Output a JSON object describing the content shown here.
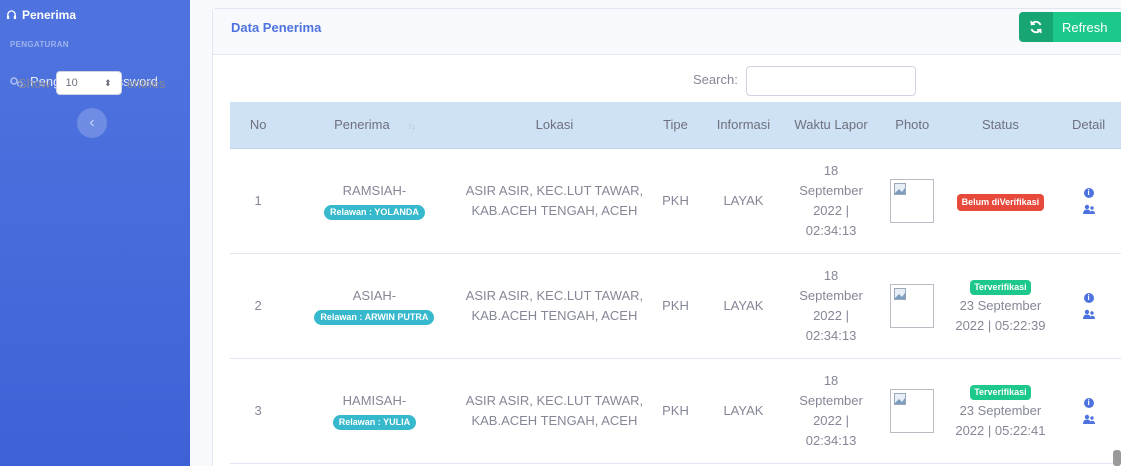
{
  "sidebar": {
    "top_item": {
      "label": "Penerima",
      "icon": "headset-icon"
    },
    "section_heading": "PENGATURAN",
    "items": [
      {
        "label": "Pengaturan Password",
        "icon": "gears-icon"
      }
    ],
    "toggle_icon": "chevron-left-icon"
  },
  "card": {
    "title": "Data Penerima",
    "refresh_label": "Refresh",
    "refresh_icon": "sync-icon"
  },
  "controls": {
    "show_label": "Show",
    "entries_value": "10",
    "entries_label": "entries",
    "search_label": "Search:",
    "search_value": ""
  },
  "table": {
    "headers": [
      "No",
      "Penerima",
      "Lokasi",
      "Tipe",
      "Informasi",
      "Waktu Lapor",
      "Photo",
      "Status",
      "Detail"
    ],
    "rows": [
      {
        "no": "1",
        "name": "RAMSIAH-",
        "relawan": "Relawan : YOLANDA",
        "lokasi": "ASIR ASIR, KEC.LUT TAWAR, KAB.ACEH TENGAH, ACEH",
        "tipe": "PKH",
        "informasi": "LAYAK",
        "waktu_lapor": "18 September 2022 | 02:34:13",
        "status_badge": "Belum diVerifikasi",
        "status_type": "danger",
        "status_time": ""
      },
      {
        "no": "2",
        "name": "ASIAH-",
        "relawan": "Relawan : ARWIN PUTRA",
        "lokasi": "ASIR ASIR, KEC.LUT TAWAR, KAB.ACEH TENGAH, ACEH",
        "tipe": "PKH",
        "informasi": "LAYAK",
        "waktu_lapor": "18 September 2022 | 02:34:13",
        "status_badge": "Terverifikasi",
        "status_type": "success",
        "status_time": "23 September 2022 | 05:22:39"
      },
      {
        "no": "3",
        "name": "HAMISAH-",
        "relawan": "Relawan : YULIA",
        "lokasi": "ASIR ASIR, KEC.LUT TAWAR, KAB.ACEH TENGAH, ACEH",
        "tipe": "PKH",
        "informasi": "LAYAK",
        "waktu_lapor": "18 September 2022 | 02:34:13",
        "status_badge": "Terverifikasi",
        "status_type": "success",
        "status_time": "23 September 2022 | 05:22:41"
      }
    ]
  },
  "colors": {
    "sidebar": "#4e73df",
    "header_bg": "#cfe2f5",
    "title": "#4e73df",
    "success": "#1cc88a",
    "danger": "#e74a3b",
    "info": "#36b9cc"
  }
}
